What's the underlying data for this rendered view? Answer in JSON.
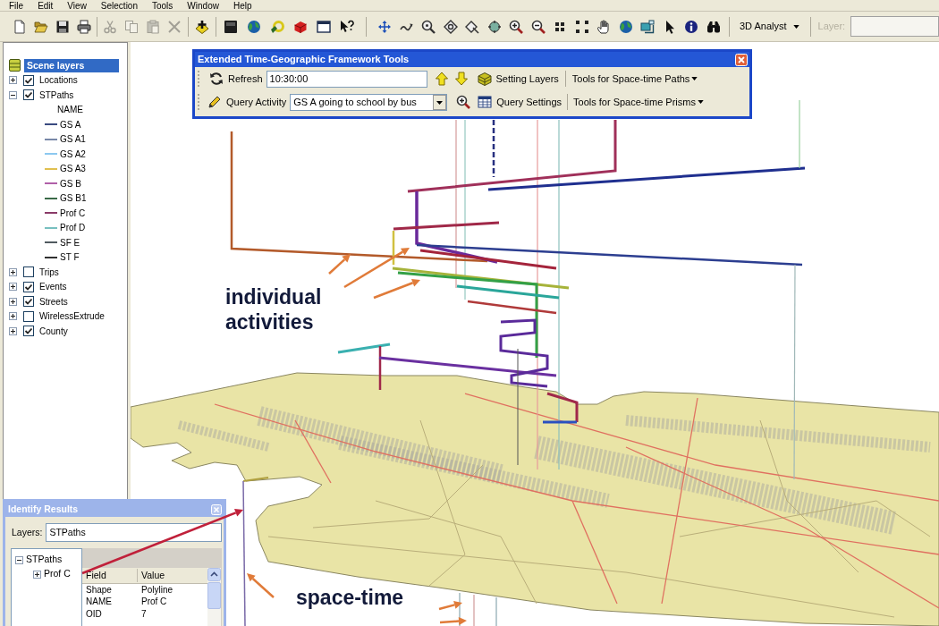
{
  "menu": [
    "File",
    "Edit",
    "View",
    "Selection",
    "Tools",
    "Window",
    "Help"
  ],
  "toolbar": {
    "groups": [
      [
        {
          "disabled": false
        },
        {
          "disabled": false
        },
        {
          "disabled": false
        },
        {
          "disabled": false
        }
      ],
      [
        {
          "disabled": true
        },
        {
          "disabled": true
        },
        {
          "disabled": true
        },
        {
          "disabled": true
        }
      ],
      [
        {
          "disabled": false
        }
      ],
      [
        {
          "disabled": false
        },
        {
          "disabled": false
        },
        {
          "disabled": false
        },
        {
          "disabled": false
        },
        {
          "disabled": false
        },
        {
          "disabled": false
        }
      ],
      [
        {
          "disabled": false
        },
        {
          "disabled": false
        },
        {
          "disabled": false
        },
        {
          "disabled": false
        },
        {
          "disabled": false
        },
        {
          "disabled": false
        },
        {
          "disabled": false
        },
        {
          "disabled": false
        },
        {
          "disabled": false
        },
        {
          "disabled": false
        },
        {
          "disabled": false
        },
        {
          "disabled": false
        },
        {
          "disabled": false
        },
        {
          "disabled": false
        },
        {
          "disabled": false
        },
        {
          "disabled": false
        }
      ]
    ],
    "analyst_menu": "3D Analyst",
    "layer_label": {
      "text": "Layer:",
      "disabled": true
    }
  },
  "table_of_contents": {
    "label": "Scene layers",
    "selected": true,
    "children": [
      {
        "label": "Locations",
        "checked": true,
        "expanded": false,
        "selected": false
      },
      {
        "label": "STPaths",
        "checked": true,
        "expanded": true,
        "selected": false,
        "legend": {
          "heading": "NAME",
          "items": [
            {
              "label": "GS A",
              "color": "#3a4a80"
            },
            {
              "label": "GS A1",
              "color": "#7888a8"
            },
            {
              "label": "GS A2",
              "color": "#8cc8f0"
            },
            {
              "label": "GS A3",
              "color": "#e0c050"
            },
            {
              "label": "GS B",
              "color": "#b060a8"
            },
            {
              "label": "GS B1",
              "color": "#3a6a48"
            },
            {
              "label": "Prof C",
              "color": "#8a3a68"
            },
            {
              "label": "Prof D",
              "color": "#78c0c0"
            },
            {
              "label": "SF E",
              "color": "#505a60"
            },
            {
              "label": "ST F",
              "color": "#303030"
            }
          ]
        }
      },
      {
        "label": "Trips",
        "checked": false,
        "expanded": false,
        "selected": false
      },
      {
        "label": "Events",
        "checked": true,
        "expanded": false,
        "selected": false
      },
      {
        "label": "Streets",
        "checked": true,
        "expanded": false,
        "selected": false
      },
      {
        "label": "WirelessExtrude",
        "checked": false,
        "expanded": false,
        "selected": false
      },
      {
        "label": "County",
        "checked": true,
        "expanded": false,
        "selected": false
      }
    ]
  },
  "time_geography_toolbar": {
    "title": "Extended Time-Geographic Framework Tools",
    "refresh_button": "Refresh",
    "time_value": "10:30:00",
    "setting_layers_button": "Setting Layers",
    "paths_menu": "Tools for Space-time Paths",
    "query_button": "Query Activity",
    "activity_value": "GS A going to school by bus",
    "query_settings_button": "Query Settings",
    "prisms_menu": "Tools for Space-time Prisms"
  },
  "scene": {
    "annotations": [
      "individual activities",
      "space-time"
    ]
  },
  "identify_results": {
    "title": "Identify Results",
    "layers_label": "Layers:",
    "layers_value": "STPaths",
    "tree": [
      {
        "label": "STPaths",
        "expanded": true,
        "children": [
          {
            "label": "Prof C",
            "expanded": false
          }
        ]
      }
    ],
    "columns": [
      "Field",
      "Value"
    ],
    "rows": [
      [
        "Shape",
        "Polyline"
      ],
      [
        "NAME",
        "Prof C"
      ],
      [
        "OID",
        "7"
      ]
    ]
  }
}
